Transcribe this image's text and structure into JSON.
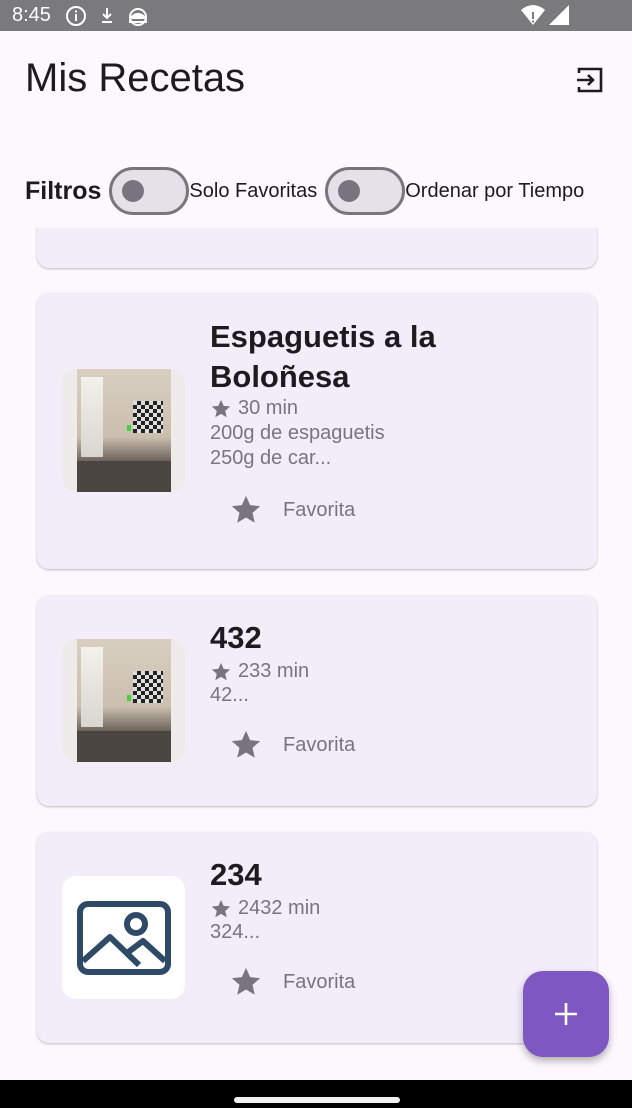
{
  "status_bar": {
    "time": "8:45",
    "icons": [
      "info-icon",
      "download-icon",
      "android-icon",
      "wifi-icon",
      "signal-icon"
    ]
  },
  "app_bar": {
    "title": "Mis Recetas",
    "logout_icon": "logout-icon"
  },
  "filters": {
    "label": "Filtros",
    "favorites_switch": {
      "label": "Solo Favoritas",
      "on": false
    },
    "sort_switch": {
      "label": "Ordenar por Tiempo",
      "on": false
    }
  },
  "recipes": [
    {
      "title": "Espaguetis a la Boloñesa",
      "time": "30 min",
      "description": "200g de espaguetis\n250g de car...",
      "favorite_label": "Favorita",
      "image": "room-photo"
    },
    {
      "title": "432",
      "time": "233 min",
      "description": "42...",
      "favorite_label": "Favorita",
      "image": "room-photo"
    },
    {
      "title": "234",
      "time": "2432 min",
      "description": "324...",
      "favorite_label": "Favorita",
      "image": "image-placeholder-icon"
    }
  ],
  "fab": {
    "icon": "plus-icon"
  },
  "colors": {
    "accent": "#7e57c2",
    "card_bg": "#f2edf8",
    "page_bg": "#fdf8fe",
    "muted_text": "#79747e"
  }
}
